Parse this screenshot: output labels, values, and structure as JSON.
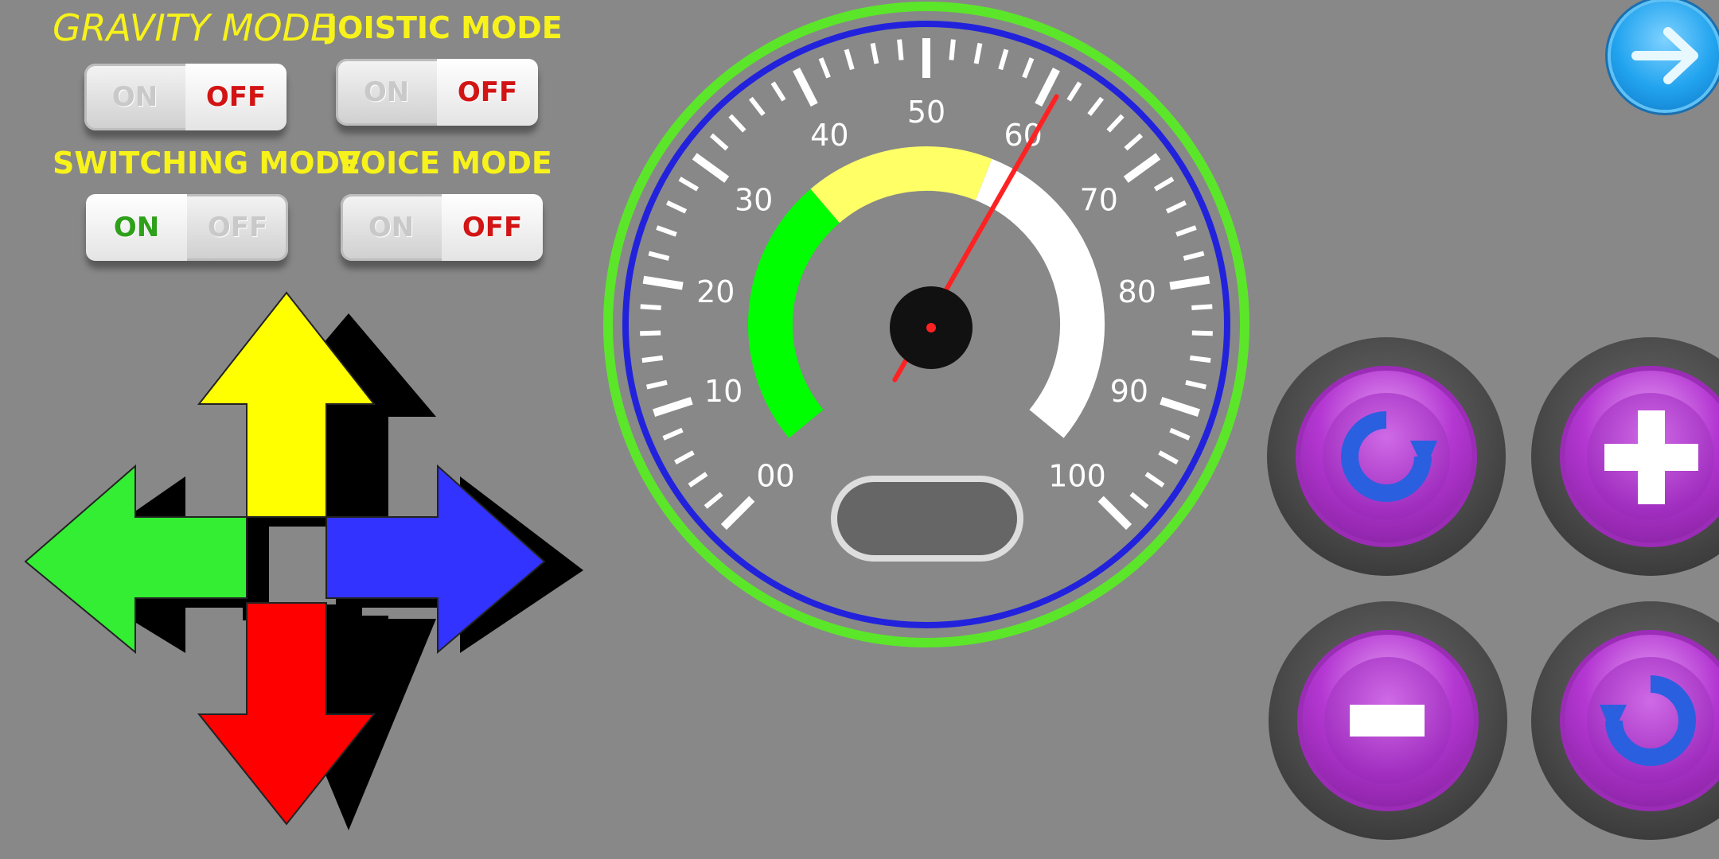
{
  "modes": {
    "gravity": {
      "label": "GRAVITY MODE",
      "on": "ON",
      "off": "OFF",
      "state": "off"
    },
    "joistic": {
      "label": "JOISTIC MODE",
      "on": "ON",
      "off": "OFF",
      "state": "off"
    },
    "switching": {
      "label": "SWITCHING MODE",
      "on": "ON",
      "off": "OFF",
      "state": "on"
    },
    "voice": {
      "label": "VOICE MODE",
      "on": "ON",
      "off": "OFF",
      "state": "off"
    }
  },
  "gauge": {
    "labels": [
      "00",
      "10",
      "20",
      "30",
      "40",
      "50",
      "60",
      "70",
      "80",
      "90",
      "100"
    ],
    "value": 61,
    "min": 0,
    "max": 100,
    "readout": ""
  },
  "dpad": {
    "up": {
      "icon": "up-arrow-icon",
      "color": "#ffff00"
    },
    "down": {
      "icon": "down-arrow-icon",
      "color": "#ff0000"
    },
    "left": {
      "icon": "left-arrow-icon",
      "color": "#33ee33"
    },
    "right": {
      "icon": "right-arrow-icon",
      "color": "#3333ff"
    }
  },
  "action_buttons": [
    {
      "name": "rotate-clockwise-button",
      "icon": "rotate-clockwise-icon"
    },
    {
      "name": "plus-button",
      "icon": "plus-icon"
    },
    {
      "name": "minus-button",
      "icon": "minus-icon"
    },
    {
      "name": "rotate-counterclockwise-button",
      "icon": "rotate-counterclockwise-icon"
    }
  ],
  "next_button": {
    "icon": "arrow-right-icon"
  },
  "colors": {
    "background": "#888888",
    "label": "#f7f21a",
    "gauge_ring": "#2222dd",
    "gauge_outer": "#5ce62a",
    "needle": "#ff2222"
  }
}
